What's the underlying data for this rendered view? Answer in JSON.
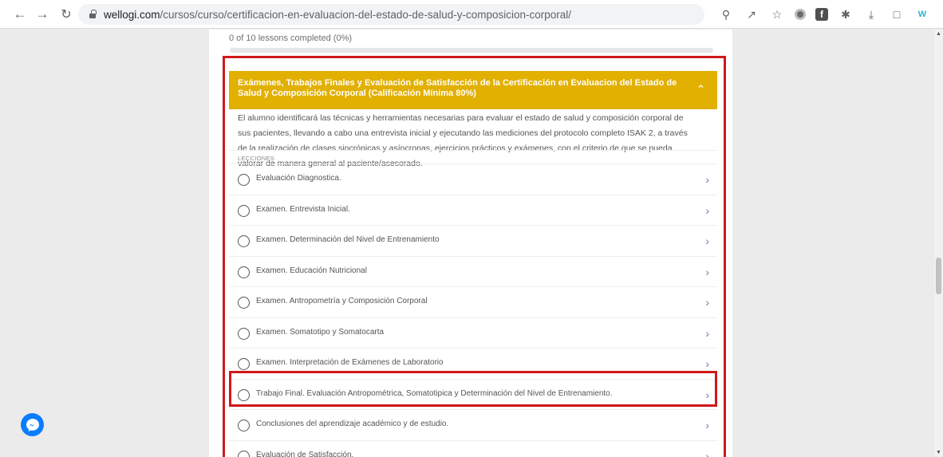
{
  "browser": {
    "url_domain": "wellogi.com",
    "url_path": "/cursos/curso/certificacion-en-evaluacion-del-estado-de-salud-y-composicion-corporal/",
    "icons": {
      "back": "back-arrow-icon",
      "forward": "forward-arrow-icon",
      "reload": "reload-icon",
      "zoom": "zoom-icon",
      "share": "share-icon",
      "bookmark": "star-icon",
      "extensions": [
        "extension-circle-icon",
        "facebook-extension-icon",
        "puzzle-icon",
        "download-icon",
        "tab-icon",
        "wellogi-logo-icon",
        "menu-icon"
      ]
    }
  },
  "course": {
    "progress_text": "0 of 10 lessons completed (0%)",
    "progress_percent": 0,
    "section_title": "Exámenes, Trabajos Finales y Evaluación de Satisfacción de la Certificación en Evaluacion del Estado de Salud y Composición Corporal (Calificación Mínima 80%)",
    "description": "El alumno identificará las técnicas y herramientas necesarias para evaluar el estado de salud y composición corporal de sus pacientes, llevando a cabo una entrevista inicial y ejecutando las mediciones del protocolo completo ISAK 2, a través de la realización de clases sincrónicas y asíncronas, ejercicios prácticos y exámenes, con el criterio de que se pueda valorar de manera general al paciente/asesorado.",
    "lessons_label": "LECCIONES",
    "lessons": [
      {
        "title": "Evaluación Diagnostica."
      },
      {
        "title": "Examen. Entrevista Inicial."
      },
      {
        "title": "Examen. Determinación del Nivel de Entrenamiento"
      },
      {
        "title": "Examen. Educación Nutricional"
      },
      {
        "title": "Examen. Antropometría y Composición Corporal"
      },
      {
        "title": "Examen. Somatotipo y Somatocarta"
      },
      {
        "title": "Examen. Interpretación de Exámenes de Laboratorio"
      },
      {
        "title": "Trabajo Final. Evaluación Antropométrica, Somatotipica y Determinación del Nivel de Entrenamiento."
      },
      {
        "title": "Conclusiones del aprendizaje académico y de estudio."
      },
      {
        "title": "Evaluación de Satisfacción."
      }
    ]
  },
  "colors": {
    "accent": "#e2b000",
    "annotation": "#d01818",
    "messenger": "#0a7cff"
  }
}
